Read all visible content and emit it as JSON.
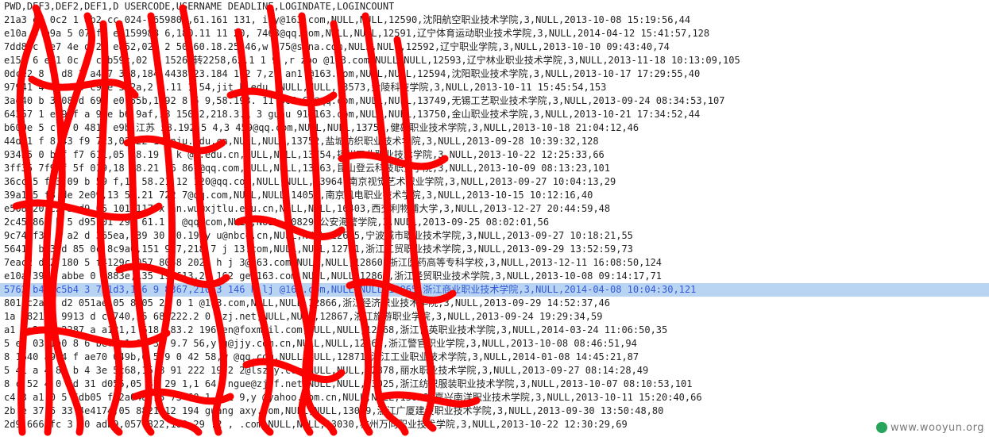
{
  "document": {
    "header_line": "PWD,DEF3,DEF2,DEF1,D",
    "header_line_2": "USERCODE,USERNAME",
    "header_line_3": "DEADLINE,LOGINDATE,LOGINCOUNT",
    "selected_row": 21,
    "lines": [
      "21a3  ed  0c2  1    db2  cc,024-865980  ,61.161    131,       ily@163.com,NULL,NULL,12590,沈阳航空职业技术学院,3,NULL,2013-10-08 15:19:56,44",
      "e10a  9  b9a  5  07  f8  e,159988  6,180.11  11  20,      7468@qq.com,NULL,NULL,12591,辽宁体育运动职业技术学院,3,NULL,2014-04-12 15:41:57,128",
      "7dd8  c  fe7  4e  d  2c  e852,024  2  50,60.18.25  46,w      175@sina.com,NULL,NULL,12592,辽宁职业学院,3,NULL,2013-10-10 09:43:40,74",
      "e152  6  ed1  0c  6  c  b59c,02  8  1526  转2258,62.1  1  9  ,r  zbo  @163.com,NULL,NULL,12593,辽宁林业职业技术学院,3,NULL,2013-11-18 10:13:09,105",
      "0dce2  8  f  d8  3  a497  338,184  4438  23.184  1.2  7,zh  an1  @163.com,NULL,NULL,12594,沈阳职业技术学院,3,NULL,2013-10-17 17:29:55,40",
      "97941  4  c1  c  9  c9ee  3b2a,2  8.11  1  54,jit  b  edu  ,NULL,NULL,13573,金陵科技学院,3,NULL,2013-10-11 15:45:54,153",
      "3ae40  b  3  08  d  694  e0  55b,1392  8  5  9,58.193.  11  365  67@qq.com,NULL,NULL,13749,无锡工艺职业技术学院,3,NULL,2013-09-24 08:34:53,107",
      "64357  1  e  94f  a  9  e  b6  9af,18  150  2,218.3.1  3  guhu  91@163.com,NULL,NULL,13750,金山职业技术学院,3,NULL,2013-10-21 17:34:52,44",
      "b600e  5  c  5  0  4819  e9b,江苏  58.192  5  4,3  459@qq.com,NULL,NULL,13751,健雄职业技术学院,3,NULL,2013-10-18 21:04:12,46",
      "44dc1  f  8  43  f9  7c3,02  22  18  nju.edu.cn,NULL,NULL,13752,盐城纺织职业技术学院,3,NULL,2013-09-28 10:39:32,128",
      "934b5  0  b  f  f7  611,05  58.19  0  k  @i.edu.cn,NULL,NULL,13754,扬州工业职业技术学院,3,NULL,2013-10-22 12:25:33,66",
      "3ff35  7f9  f  5f  019,18  58.21  16  867@qq.com,NULL,NULL,13963,昆山登云科技职业学院,3,NULL,2013-10-09 08:13:23,101",
      "36cc  5  f  3  09  b  59  f,13  58.21  12  120@qq.com,NULL,NULL,13964,南京视觉艺术职业学院,3,NULL,2013-09-27 10:04:13,29",
      "39a1  5  f8  de  2e09,13  58.21  722  7@qq.com,NULL,NULL,14056,南京机电职业技术学院,3,NULL,2013-10-15 10:12:16,40",
      "e508  20  c2  3  d9,05  101  117  x  an.wu@xjtlu.edu.cn,NULL,NULL,16403,西交利物浦大学,3,NULL,2013-12-27 20:44:59,48",
      "2c45  867  b  5  d95,01  297  61.1  5  @qq.com,NULL,NULL,10829,公安海警学院,3,NULL,2013-09-25 08:02:01,56",
      "9c74  f31  8  a2  d  365ea,139  30  50.19  y  u@nbcc.cn,NULL,NULL,12645,宁波城市职业技术学院,3,NULL,2013-09-27 10:18:21,55",
      "56417  bb3  d  85  0c  8c9a0,151  917,218.7  j  13.com,NULL,NULL,12791,浙江工贸职业技术学院,3,NULL,2013-09-29 13:52:59,73",
      "7eac2  d52  180  5  f4129c,057  8058  202.  h  j  3@163.com,NULL,NULL,12860,浙江医药高等专科学校,3,NULL,2013-12-11 16:08:50,124",
      "e10a  3949  abbe  0  f883e,135  19  613,20  162  ge@163.com,NULL,NULL,12864,浙江经贸职业技术学院,3,NULL,2013-10-08 09:14:17,71",
      "5762  b4a  c5b4  3  731d3,136  9  8367,210.3  146  h  lj  @163.com,NULL,NULL,12865,浙江商业职业技术学院,3,NULL,2014-04-08 10:04:30,121",
      "801  c2a  9  d2  051ae,05  8105  21  0  1  @163.com,NULL,NULL,12866,浙江经济职业技术学院,3,NULL,2013-09-29 14:52:37,46",
      "1a  5821  a  9913  d  c8740,15  68  222.2  0  czj.net,NULL,NULL,12867,浙江旅游职业学院,3,NULL,2013-09-24 19:29:34,59",
      "a1  0a2  5c  2287  a  a121,1  618,183.2  196  en@foxmail.com,NULL,NULL,12868,浙江育英职业技术学院,3,NULL,2014-03-24 11:06:50,35",
      "5  e5  03  1a0  8  6  bef3,1  96  33  9.7  56,y  g@jjy.com.cn,NULL,NULL,12869,浙江警官职业学院,3,NULL,2013-10-08 08:46:51,94",
      "8  1640  a9  4  f  ae70  049b,0  5  9  0  42  58,w  @qq.com,NULL,NULL,12871,浙江工业职业技术学院,3,NULL,2014-01-08 14:45:21,87",
      "5  41  a  4  88  b  4  3e  5c68,15  8  91  222  19  2  2@lszjy.com,NULL,NULL,12878,丽水职业技术学院,3,NULL,2013-09-27 08:14:28,49",
      "8  c  52  4  0  6d  31  d055,05  47  29  1,1  64,  ngue@zjff.net,NULL,NULL,13025,浙江纺织服装职业技术学院,3,NULL,2013-10-07 08:10:53,101",
      "c4  3  a1  0  5  6db05  fa2a04a,15  73  60.1  0  1  9,y  @yahoo.com.cn,NULL,NULL,13028,嘉兴南洋职业技术学院,3,NULL,2013-10-11 15:20:40,66",
      "2b  e  37  6  33  4e4174,05  8821,12  194  guang  axy.com,NULL,NULL,13029,浙江广厦建设职业技术学院,3,NULL,2013-09-30 13:50:48,80",
      "2d9  666  fc  3  e0  adb9,057  822,183  29  .2  ,  .com,NULL,NULL,13030,杭州万向职业技术学院,3,NULL,2013-10-22 12:30:29,69"
    ]
  },
  "watermark": {
    "text": "www.wooyun.org",
    "logo_color": "#27a55a"
  },
  "colors": {
    "scribble": "#ff0000",
    "selection_bg": "#b8d4f2",
    "selection_text": "#3359d6",
    "text": "#222222"
  }
}
